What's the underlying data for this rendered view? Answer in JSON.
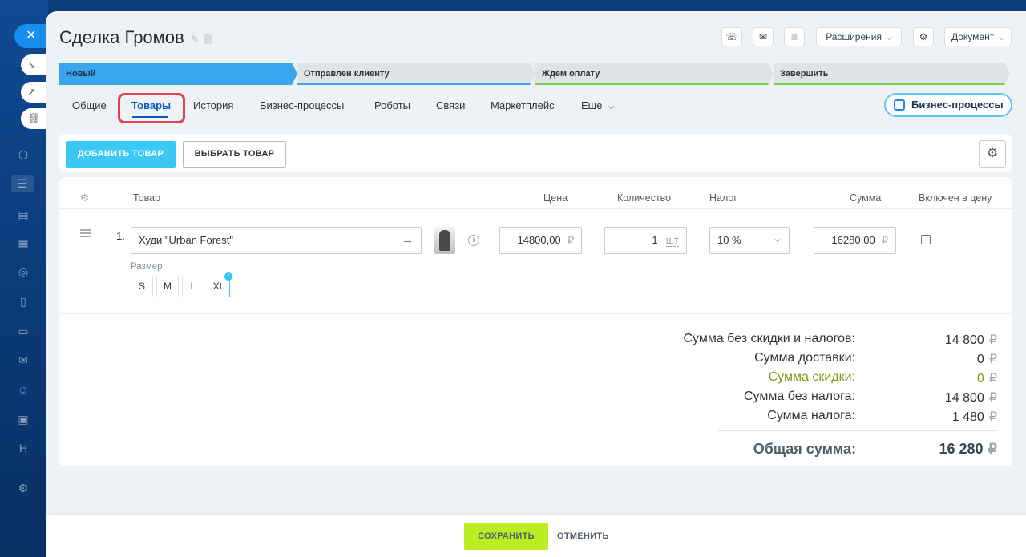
{
  "header": {
    "title": "Сделка Громов",
    "extensions_label": "Расширения",
    "document_label": "Документ"
  },
  "stages": [
    "Новый",
    "Отправлен клиенту",
    "Ждем оплату",
    "Завершить"
  ],
  "tabs": [
    {
      "label": "Общие"
    },
    {
      "label": "Товары"
    },
    {
      "label": "История"
    },
    {
      "label": "Бизнес-процессы"
    },
    {
      "label": "Роботы"
    },
    {
      "label": "Связи"
    },
    {
      "label": "Маркетплейс"
    },
    {
      "label": "Еще"
    }
  ],
  "bp_button_label": "Бизнес-процессы",
  "toolbar": {
    "add_label": "ДОБАВИТЬ ТОВАР",
    "select_label": "ВЫБРАТЬ ТОВАР"
  },
  "table": {
    "headers": {
      "product": "Товар",
      "price": "Цена",
      "quantity": "Количество",
      "tax": "Налог",
      "sum": "Сумма",
      "included": "Включен в цену"
    },
    "rows": [
      {
        "num": "1.",
        "name": "Худи \"Urban Forest\"",
        "price": "14800,00",
        "currency": "₽",
        "quantity": "1",
        "unit": "шт",
        "tax": "10 %",
        "sum": "16280,00",
        "included": false,
        "size_label": "Размер",
        "sizes": [
          "S",
          "M",
          "L",
          "XL"
        ],
        "selected_size": "XL"
      }
    ]
  },
  "totals": {
    "rows": [
      {
        "label": "Сумма без скидки и налогов:",
        "value": "14 800"
      },
      {
        "label": "Сумма доставки:",
        "value": "0"
      },
      {
        "label": "Сумма скидки:",
        "value": "0"
      },
      {
        "label": "Сумма без налога:",
        "value": "14 800"
      },
      {
        "label": "Сумма налога:",
        "value": "1 480"
      }
    ],
    "grand_label": "Общая сумма:",
    "grand_value": "16 280",
    "currency": "₽"
  },
  "footer": {
    "save_label": "СОХРАНИТЬ",
    "cancel_label": "ОТМЕНИТЬ"
  },
  "colors": {
    "accent": "#3bc8f5",
    "active_tab": "#1058c7",
    "highlight": "#e0434e",
    "save": "#bbed21",
    "discount": "#7a9a16"
  }
}
